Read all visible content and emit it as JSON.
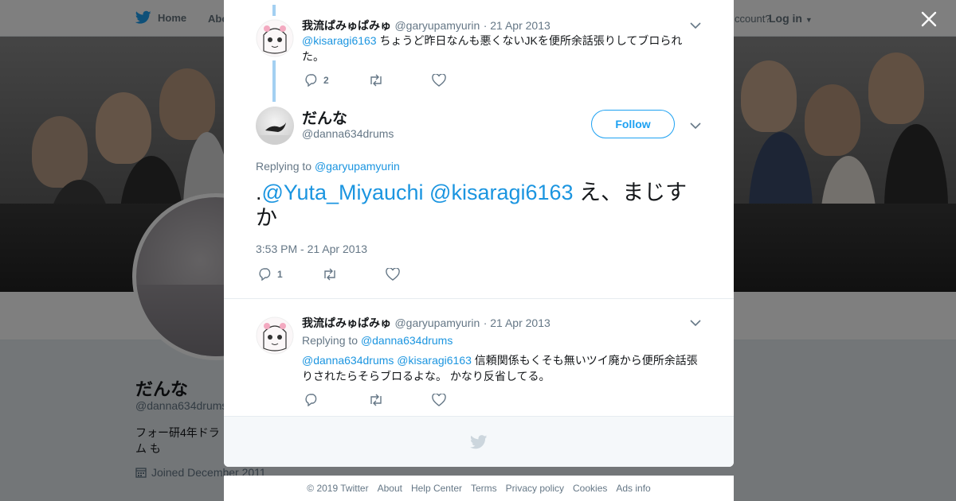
{
  "topbar": {
    "home_label": "Home",
    "about_label": "Abo",
    "account_label": "ccount?",
    "login_label": "Log in"
  },
  "profile": {
    "name": "だんな",
    "handle": "@danna634drums",
    "bio": "フォー研4年ドラム も",
    "joined": "Joined December 2011"
  },
  "modal": {
    "tweets": [
      {
        "name": "我流ぱみゅぱみゅ",
        "handle": "@garyupamyurin",
        "date": "· 21 Apr 2013",
        "mention": "@kisaragi6163",
        "text": " ちょうど昨日なんも悪くないJKを便所余話張りしてブロられた。",
        "reply_count": "2"
      },
      {
        "name": "だんな",
        "handle": "@danna634drums",
        "follow_label": "Follow",
        "replying_label": "Replying to ",
        "replying_handle": "@garyupamyurin",
        "text_prefix": ".",
        "mention1": "@Yuta_Miyauchi",
        "mention2": "@kisaragi6163",
        "text": " え、まじすか",
        "timestamp": "3:53 PM - 21 Apr 2013",
        "reply_count": "1"
      },
      {
        "name": "我流ぱみゅぱみゅ",
        "handle": "@garyupamyurin",
        "date": "· 21 Apr 2013",
        "replying_label": "Replying to ",
        "replying_handle": "@danna634drums",
        "mention1": "@danna634drums",
        "mention2": "@kisaragi6163",
        "text": " 信頼関係もくそも無いツイ廃から便所余話張りされたらそらブロるよな。 かなり反省してる。"
      }
    ]
  },
  "footer": {
    "links": [
      "© 2019 Twitter",
      "About",
      "Help Center",
      "Terms",
      "Privacy policy",
      "Cookies",
      "Ads info"
    ]
  },
  "colors": {
    "accent": "#1da1f2",
    "link": "#1b95e0",
    "thread_line": "#a3d0f2"
  }
}
